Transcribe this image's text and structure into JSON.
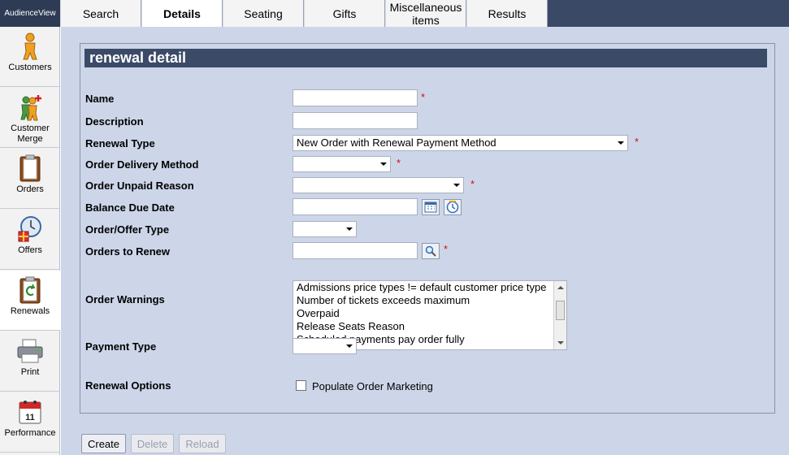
{
  "brand": "AudienceView",
  "tabs": [
    {
      "label": "Search"
    },
    {
      "label": "Details"
    },
    {
      "label": "Seating"
    },
    {
      "label": "Gifts"
    },
    {
      "label": "Miscellaneous items"
    },
    {
      "label": "Results"
    }
  ],
  "sidebar": [
    {
      "label": "Customers",
      "icon": "customer-icon"
    },
    {
      "label": "Customer Merge",
      "icon": "customer-merge-icon"
    },
    {
      "label": "Orders",
      "icon": "orders-icon"
    },
    {
      "label": "Offers",
      "icon": "offers-icon"
    },
    {
      "label": "Renewals",
      "icon": "renewals-icon"
    },
    {
      "label": "Print",
      "icon": "printer-icon"
    },
    {
      "label": "Performance",
      "icon": "calendar-icon"
    }
  ],
  "panel": {
    "title": "renewal detail"
  },
  "form": {
    "name": {
      "label": "Name",
      "value": "",
      "required": "*"
    },
    "description": {
      "label": "Description",
      "value": ""
    },
    "renewal_type": {
      "label": "Renewal Type",
      "value": "New Order with Renewal Payment Method",
      "required": "*"
    },
    "delivery_method": {
      "label": "Order Delivery Method",
      "value": "",
      "required": "*"
    },
    "unpaid_reason": {
      "label": "Order Unpaid Reason",
      "value": "",
      "required": "*"
    },
    "balance_due": {
      "label": "Balance Due Date",
      "value": ""
    },
    "offer_type": {
      "label": "Order/Offer Type",
      "value": ""
    },
    "orders_to_renew": {
      "label": "Orders to Renew",
      "value": "",
      "required": "*"
    },
    "order_warnings": {
      "label": "Order Warnings",
      "options": [
        "Admissions price types != default customer price type",
        "Number of tickets exceeds maximum",
        "Overpaid",
        "Release Seats Reason",
        "Scheduled payments pay order fully"
      ]
    },
    "payment_type": {
      "label": "Payment Type",
      "value": ""
    },
    "renewal_options": {
      "label": "Renewal Options",
      "checkbox_label": "Populate Order Marketing",
      "checked": false
    }
  },
  "buttons": {
    "create": "Create",
    "delete": "Delete",
    "reload": "Reload"
  },
  "colors": {
    "header_bar": "#3b4a66",
    "content_bg": "#cdd6e9",
    "required": "#d01010"
  }
}
